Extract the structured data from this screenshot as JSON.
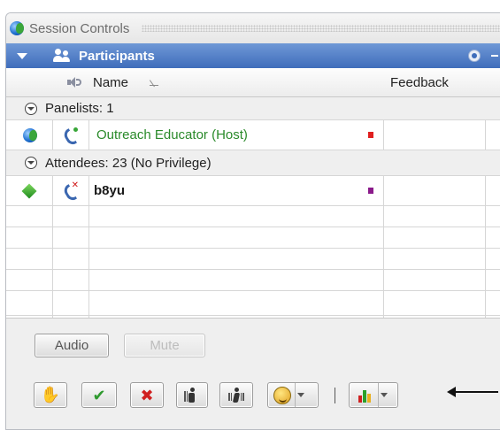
{
  "window": {
    "title": "Session Controls"
  },
  "panel": {
    "title": "Participants"
  },
  "columns": {
    "name": "Name",
    "feedback": "Feedback"
  },
  "groups": {
    "panelists": "Panelists: 1",
    "attendees": "Attendees: 23 (No Privilege)"
  },
  "participants": [
    {
      "name": "Outreach Educator (Host)",
      "role_icon": "globe-icon",
      "phone_icon": "phone-connected-icon",
      "status_color": "#e02020",
      "name_color": "#2a8a2a"
    },
    {
      "name": "b8yu",
      "role_icon": "green-diamond-icon",
      "phone_icon": "phone-muted-icon",
      "status_color": "#8a1a8a",
      "name_color": "#1a1a1a"
    }
  ],
  "controls": {
    "audio_label": "Audio",
    "mute_label": "Mute",
    "toolbar": [
      "raise-hand-icon",
      "yes-check-icon",
      "no-x-icon",
      "go-slower-icon",
      "go-faster-icon",
      "emoticons-icon",
      "polling-chart-icon"
    ]
  },
  "colors": {
    "panel_header_top": "#6f98d6",
    "panel_header_bottom": "#3f6dbb",
    "host_name": "#2a8a2a"
  }
}
